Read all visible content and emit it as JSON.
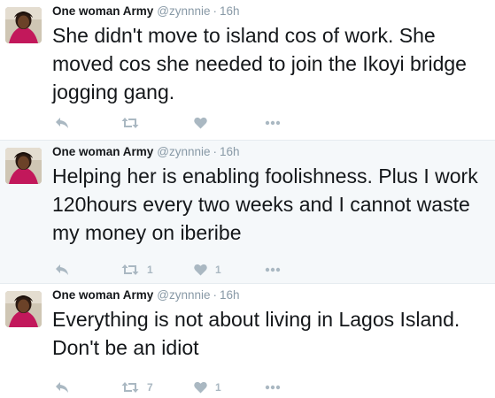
{
  "colors": {
    "text": "#14171a",
    "meta": "#8899a6",
    "action_icon": "#aab8c2",
    "highlight_bg": "#f5f8fa",
    "divider": "#e6ecf0"
  },
  "icons": {
    "reply": "reply-icon",
    "retweet": "retweet-icon",
    "like": "heart-icon",
    "more": "more-icon"
  },
  "tweets": [
    {
      "name": "One woman Army",
      "handle": "@zynnnie",
      "separator": "·",
      "time": "16h",
      "text": "She didn't move to island cos of work. She moved cos she needed to join the Ikoyi bridge jogging gang.",
      "retweets": "",
      "likes": ""
    },
    {
      "name": "One woman Army",
      "handle": "@zynnnie",
      "separator": "·",
      "time": "16h",
      "text": "Helping her is enabling foolishness. Plus I work 120hours every two weeks and I cannot waste my money on iberibe",
      "retweets": "1",
      "likes": "1"
    },
    {
      "name": "One woman Army",
      "handle": "@zynnnie",
      "separator": "·",
      "time": "16h",
      "text": "Everything is not about living in Lagos Island. Don't be an idiot",
      "retweets": "7",
      "likes": "1"
    }
  ]
}
